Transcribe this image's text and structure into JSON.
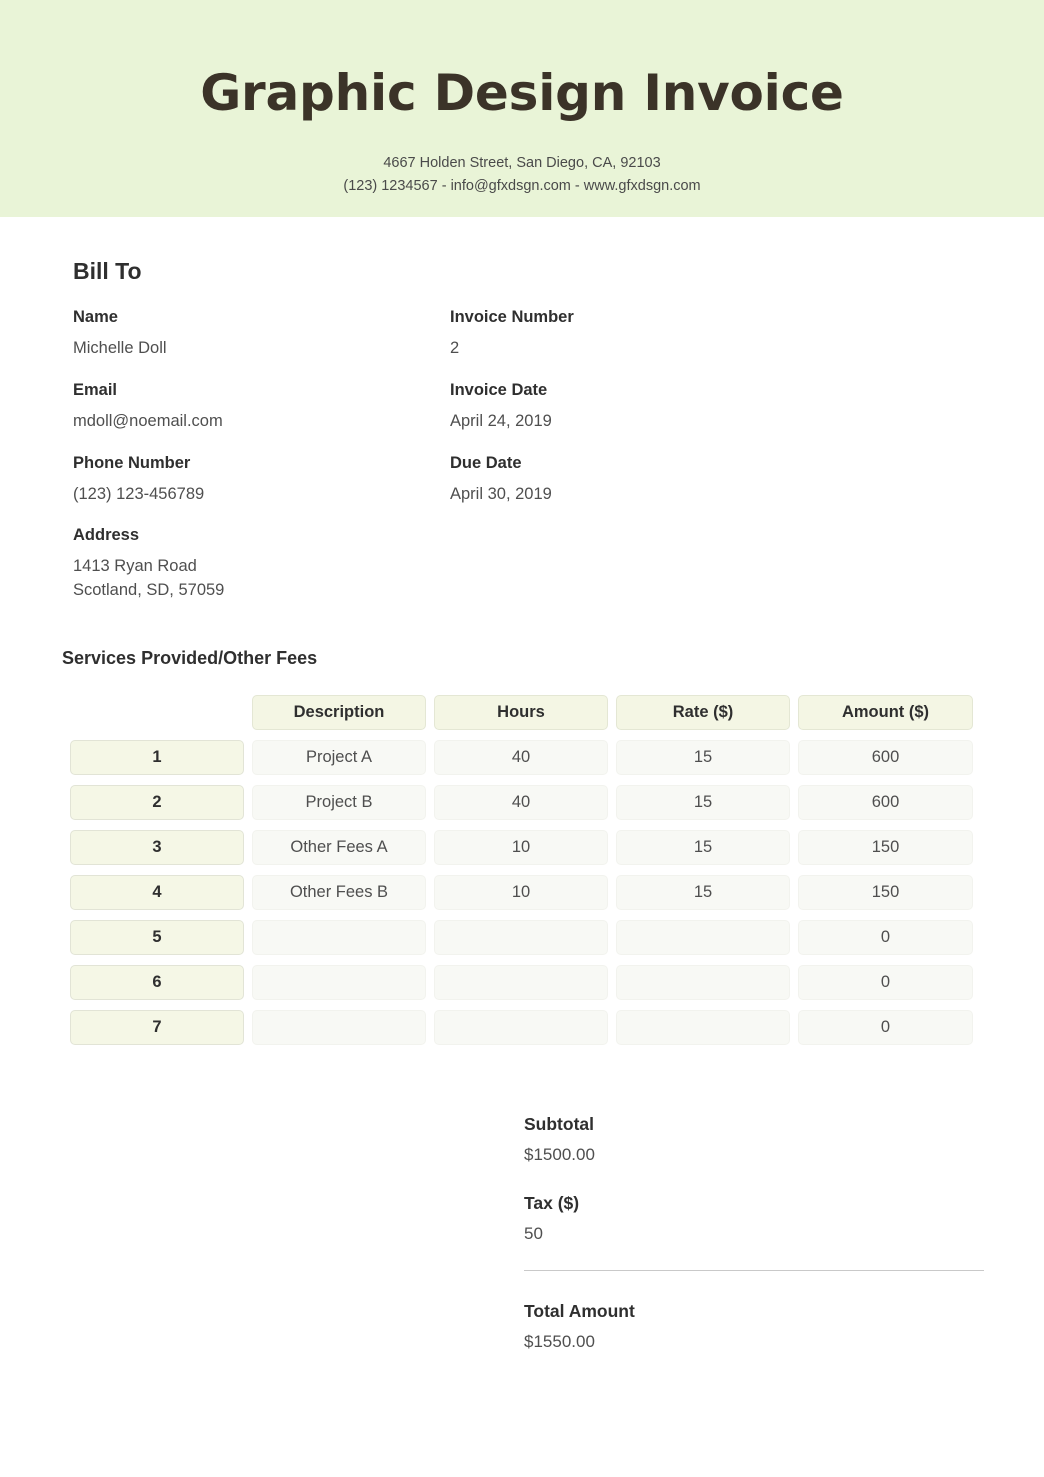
{
  "header": {
    "title": "Graphic Design Invoice",
    "address_line": "4667 Holden Street, San Diego, CA, 92103",
    "contact_line": "(123) 1234567 - info@gfxdsgn.com - www.gfxdsgn.com",
    "band_color": "#e9f4d7",
    "title_color": "#3b3328"
  },
  "bill_to": {
    "heading": "Bill To",
    "left_fields": [
      {
        "label": "Name",
        "value": "Michelle Doll"
      },
      {
        "label": "Email",
        "value": "mdoll@noemail.com"
      },
      {
        "label": "Phone Number",
        "value": "(123) 123-456789"
      },
      {
        "label": "Address",
        "value": "1413 Ryan Road\nScotland, SD, 57059"
      }
    ],
    "right_fields": [
      {
        "label": "Invoice Number",
        "value": "2"
      },
      {
        "label": "Invoice Date",
        "value": "April 24, 2019"
      },
      {
        "label": "Due Date",
        "value": "April 30, 2019"
      }
    ]
  },
  "services": {
    "heading": "Services Provided/Other Fees",
    "columns": [
      "Description",
      "Hours",
      "Rate ($)",
      "Amount ($)"
    ],
    "rows": [
      {
        "num": "1",
        "description": "Project A",
        "hours": "40",
        "rate": "15",
        "amount": "600"
      },
      {
        "num": "2",
        "description": "Project B",
        "hours": "40",
        "rate": "15",
        "amount": "600"
      },
      {
        "num": "3",
        "description": "Other Fees A",
        "hours": "10",
        "rate": "15",
        "amount": "150"
      },
      {
        "num": "4",
        "description": "Other Fees B",
        "hours": "10",
        "rate": "15",
        "amount": "150"
      },
      {
        "num": "5",
        "description": "",
        "hours": "",
        "rate": "",
        "amount": "0"
      },
      {
        "num": "6",
        "description": "",
        "hours": "",
        "rate": "",
        "amount": "0"
      },
      {
        "num": "7",
        "description": "",
        "hours": "",
        "rate": "",
        "amount": "0"
      }
    ],
    "header_cell_color": "#f4f6e4",
    "number_cell_color": "#f5f7e6",
    "data_cell_color": "#f8f9f5"
  },
  "totals": {
    "subtotal_label": "Subtotal",
    "subtotal_value": "$1500.00",
    "tax_label": "Tax ($)",
    "tax_value": "50",
    "total_label": "Total Amount",
    "total_value": "$1550.00"
  }
}
